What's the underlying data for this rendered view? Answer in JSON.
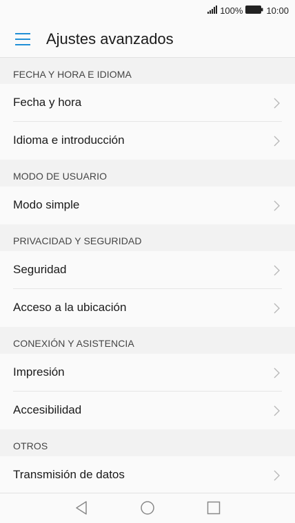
{
  "status_bar": {
    "battery_percent": "100%",
    "time": "10:00",
    "icons": [
      "signal-icon",
      "battery-icon"
    ]
  },
  "app_bar": {
    "menu_icon": "hamburger-menu-icon",
    "title": "Ajustes avanzados"
  },
  "sections": [
    {
      "header": "FECHA Y HORA E IDIOMA",
      "items": [
        {
          "label": "Fecha y hora"
        },
        {
          "label": "Idioma e introducción"
        }
      ]
    },
    {
      "header": "MODO DE USUARIO",
      "items": [
        {
          "label": "Modo simple"
        }
      ]
    },
    {
      "header": "PRIVACIDAD Y SEGURIDAD",
      "items": [
        {
          "label": "Seguridad"
        },
        {
          "label": "Acceso a la ubicación"
        }
      ]
    },
    {
      "header": "CONEXIÓN Y ASISTENCIA",
      "items": [
        {
          "label": "Impresión"
        },
        {
          "label": "Accesibilidad"
        }
      ]
    },
    {
      "header": "OTROS",
      "items": [
        {
          "label": "Transmisión de datos"
        }
      ]
    }
  ],
  "nav_bar": {
    "icons": [
      "back-icon",
      "home-icon",
      "recents-icon"
    ]
  },
  "colors": {
    "accent": "#1f8fd6",
    "background": "#f2f2f2",
    "surface": "#fafafa",
    "chevron": "#b8b8b8"
  }
}
